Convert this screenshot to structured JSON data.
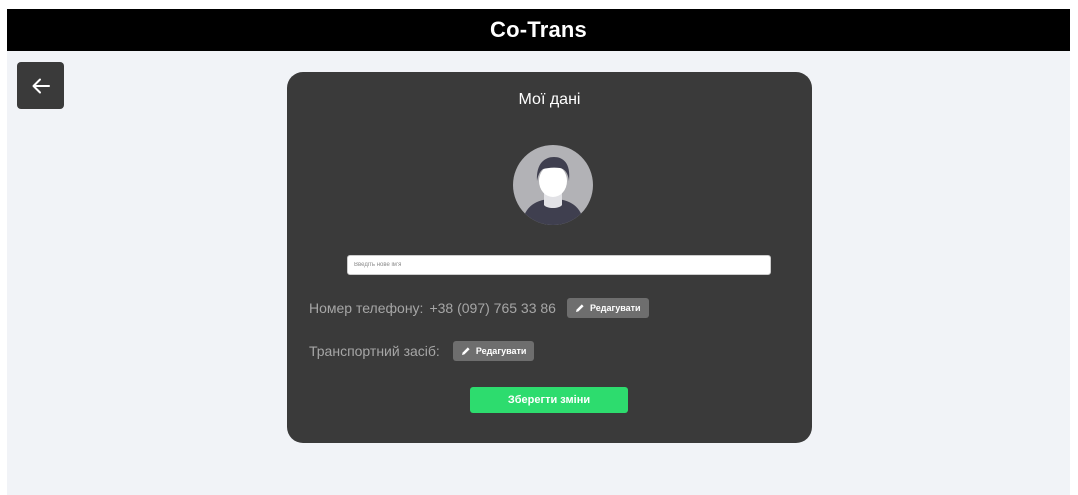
{
  "header": {
    "app_title": "Co-Trans"
  },
  "back_button": {
    "icon": "arrow-left-icon"
  },
  "profile": {
    "title": "Мої дані",
    "avatar_icon": "user-avatar-icon",
    "name_input": {
      "placeholder": "Введіть нове ім'я",
      "value": ""
    },
    "phone": {
      "label": "Номер телефону:",
      "value": "+38 (097) 765 33 86",
      "edit_label": "Редагувати",
      "edit_icon": "pencil-icon"
    },
    "vehicle": {
      "label": "Транспортний засіб:",
      "edit_label": "Редагувати",
      "edit_icon": "pencil-icon"
    },
    "save_label": "Зберегти зміни"
  },
  "colors": {
    "header_bg": "#000000",
    "page_bg": "#f1f3f7",
    "card_bg": "#3a3a3a",
    "edit_button_bg": "#6e6e6e",
    "save_button_bg": "#2ddc6e"
  }
}
